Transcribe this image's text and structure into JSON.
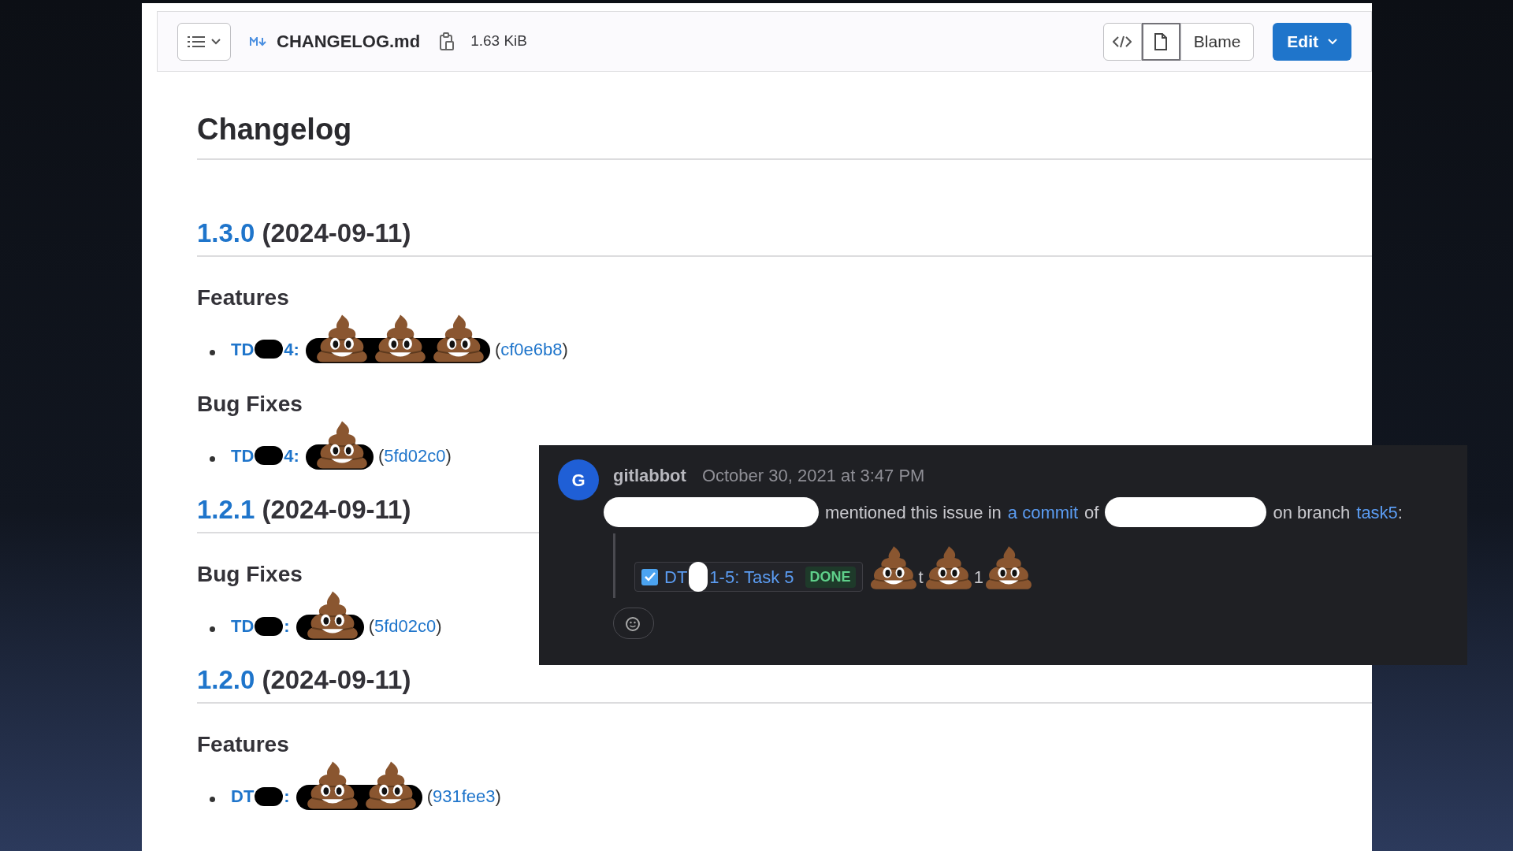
{
  "file_header": {
    "filename": "CHANGELOG.md",
    "file_size": "1.63 KiB",
    "buttons": [
      {
        "label": "Blame",
        "kind": "secondary"
      },
      {
        "label": "Edit",
        "kind": "primary"
      }
    ]
  },
  "changelog": {
    "title": "Changelog",
    "releases": [
      {
        "version": "1.3.0",
        "date": "(2024-09-11)",
        "sections": [
          {
            "heading": "Features",
            "items": [
              {
                "ref_start": "TD",
                "ref_end": "4:",
                "icons": [
                  {
                    "kind": "pile"
                  },
                  {
                    "kind": "pile"
                  },
                  {
                    "kind": "pile"
                  }
                ],
                "open": "(",
                "commit": "cf0e6b8",
                "close": ")"
              }
            ]
          },
          {
            "heading": "Bug Fixes",
            "items": [
              {
                "ref_start": "TD",
                "ref_end": "4:",
                "icons": [
                  {
                    "kind": "pile"
                  }
                ],
                "open": "(",
                "commit": "5fd02c0",
                "close": ")"
              }
            ]
          }
        ]
      },
      {
        "version": "1.2.1",
        "date": "(2024-09-11)",
        "sections": [
          {
            "heading": "Bug Fixes",
            "items": [
              {
                "ref_start": "TD",
                "ref_end": ":",
                "icons": [
                  {
                    "kind": "pile"
                  }
                ],
                "open": "(",
                "commit": "5fd02c0",
                "close": ")"
              }
            ]
          }
        ]
      },
      {
        "version": "1.2.0",
        "date": "(2024-09-11)",
        "sections": [
          {
            "heading": "Features",
            "items": [
              {
                "ref_start": "DT",
                "ref_end": ":",
                "icons": [
                  {
                    "kind": "pile"
                  },
                  {
                    "kind": "pile"
                  }
                ],
                "open": "(",
                "commit": "931fee3",
                "close": ")"
              }
            ]
          }
        ]
      }
    ]
  },
  "comment": {
    "avatar": "G",
    "author": "gitlabbot",
    "time": "October 30, 2021 at 3:47 PM",
    "message": [
      {
        "kind": "redacted"
      },
      {
        "kind": "text",
        "text": "mentioned this issue in"
      },
      {
        "kind": "link",
        "text": "a commit"
      },
      {
        "kind": "text",
        "text": "of"
      },
      {
        "kind": "redacted"
      },
      {
        "kind": "text",
        "text": "on branch"
      },
      {
        "kind": "link",
        "text": "task5"
      },
      {
        "kind": "text",
        "text": ":"
      }
    ],
    "issue": {
      "checked": true,
      "ref_start": "DT",
      "ref_end": "1-5: Task 5",
      "status": "DONE"
    },
    "trailing": [
      {
        "kind": "icon"
      },
      {
        "kind": "text",
        "text": "t"
      },
      {
        "kind": "icon"
      },
      {
        "kind": "text",
        "text": "1"
      },
      {
        "kind": "icon"
      }
    ]
  }
}
